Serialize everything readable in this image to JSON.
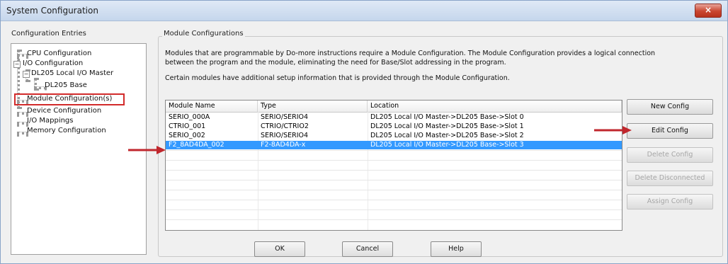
{
  "window": {
    "title": "System Configuration",
    "close_symbol": "×"
  },
  "entries": {
    "title": "Configuration Entries",
    "items": [
      {
        "label": "CPU Configuration"
      },
      {
        "label": "I/O Configuration",
        "expander": "−"
      },
      {
        "label": "DL205 Local I/O Master",
        "expander": "−"
      },
      {
        "label": "DL205 Base"
      },
      {
        "label": "Module Configuration(s)",
        "selected": true
      },
      {
        "label": "Device Configuration"
      },
      {
        "label": "I/O Mappings"
      },
      {
        "label": "Memory Configuration"
      }
    ]
  },
  "module": {
    "title": "Module Configurations",
    "desc_line1": "Modules that are programmable by Do-more instructions require a Module Configuration. The Module Configuration provides a logical connection",
    "desc_line2": "between the program and the module, eliminating the need for Base/Slot addressing in the program.",
    "desc_line3": "Certain modules have additional setup information that is provided through the Module Configuration.",
    "columns": [
      "Module Name",
      "Type",
      "Location"
    ],
    "rows": [
      {
        "name": "SERIO_000A",
        "type": "SERIO/SERIO4",
        "location": "DL205 Local I/O Master->DL205 Base->Slot 0"
      },
      {
        "name": "CTRIO_001",
        "type": "CTRIO/CTRIO2",
        "location": "DL205 Local I/O Master->DL205 Base->Slot 1"
      },
      {
        "name": "SERIO_002",
        "type": "SERIO/SERIO4",
        "location": "DL205 Local I/O Master->DL205 Base->Slot 2"
      },
      {
        "name": "F2_8AD4DA_002",
        "type": "F2-8AD4DA-x",
        "location": "DL205 Local I/O Master->DL205 Base->Slot 3",
        "selected": true
      }
    ]
  },
  "buttons": {
    "new_config": "New Config",
    "edit_config": "Edit Config",
    "delete_config": "Delete Config",
    "delete_disconnected": "Delete Disconnected",
    "assign_config": "Assign Config",
    "ok": "OK",
    "cancel": "Cancel",
    "help": "Help"
  },
  "colors": {
    "selection": "#3399ff",
    "annotation_red": "#c0272d"
  }
}
